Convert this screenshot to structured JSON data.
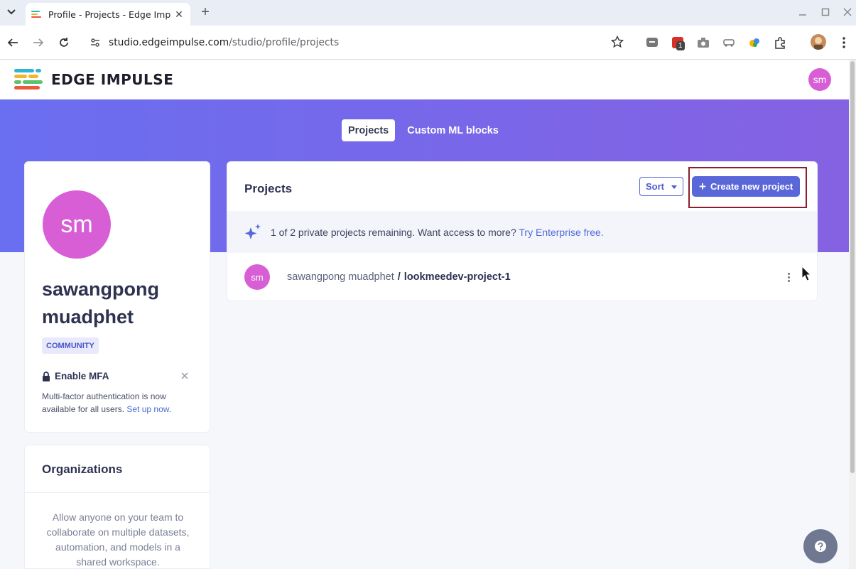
{
  "browser": {
    "tab_title": "Profile - Projects - Edge Imp",
    "url_host": "studio.edgeimpulse.com",
    "url_path": "/studio/profile/projects",
    "extension_badge": "1"
  },
  "header": {
    "logo_text": "EDGE IMPULSE",
    "avatar_initials": "sm"
  },
  "nav_tabs": [
    {
      "label": "Projects",
      "active": true
    },
    {
      "label": "Custom ML blocks",
      "active": false
    }
  ],
  "profile": {
    "avatar_initials": "sm",
    "name": "sawangpong muadphet",
    "plan_badge": "COMMUNITY",
    "mfa_title": "Enable MFA",
    "mfa_text": "Multi-factor authentication is now available for all users.",
    "mfa_link": "Set up now",
    "mfa_period": "."
  },
  "organizations": {
    "title": "Organizations",
    "text": "Allow anyone on your team to collaborate on multiple datasets, automation, and models in a shared workspace."
  },
  "projects": {
    "title": "Projects",
    "sort_label": "Sort",
    "create_label": "Create new project",
    "notice_text": "1 of 2 private projects remaining. Want access to more?",
    "notice_link": "Try Enterprise free.",
    "items": [
      {
        "avatar": "sm",
        "owner": "sawangpong muadphet",
        "separator": "/",
        "name": "lookmeedev-project-1"
      }
    ]
  },
  "help": {
    "icon": "question-icon"
  },
  "colors": {
    "accent": "#5a67d8",
    "avatar": "#d85ed6",
    "hero_start": "#6a6ef0",
    "hero_end": "#8562e2"
  }
}
